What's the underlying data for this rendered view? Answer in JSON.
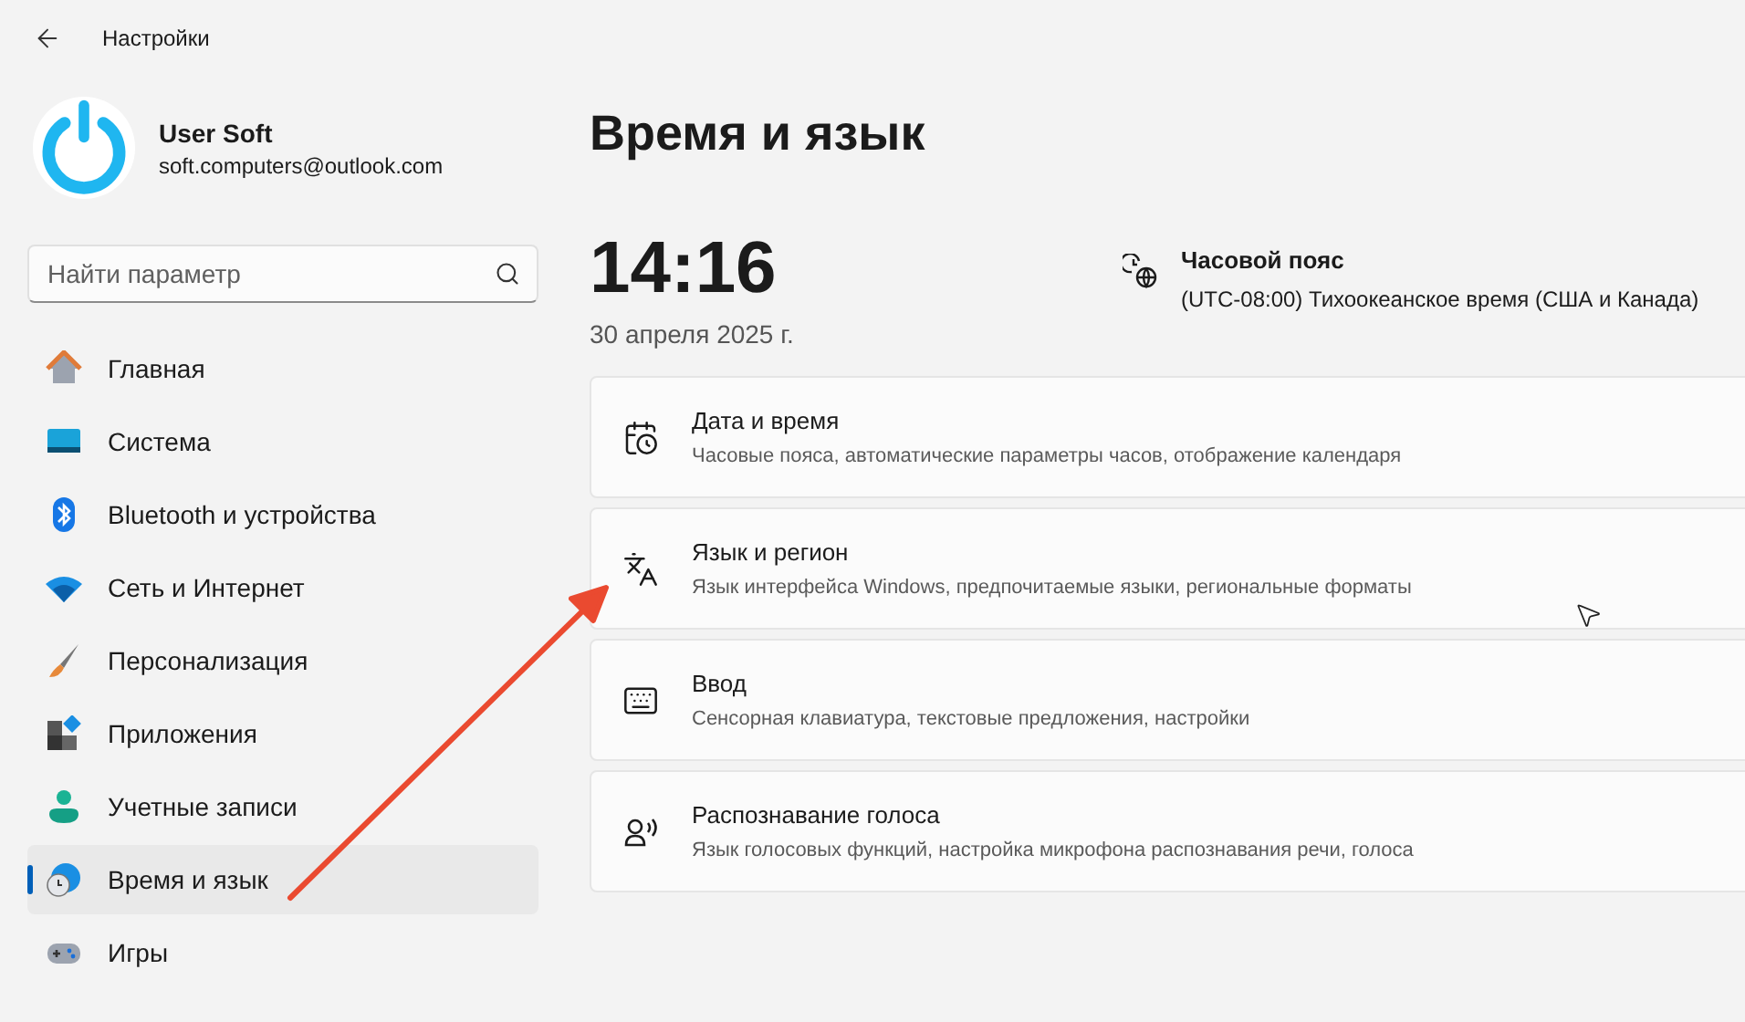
{
  "window": {
    "title": "Настройки"
  },
  "account": {
    "name": "User Soft",
    "email": "soft.computers@outlook.com"
  },
  "search": {
    "placeholder": "Найти параметр"
  },
  "sidebar": {
    "items": [
      {
        "kind": "home",
        "label": "Главная",
        "selected": false
      },
      {
        "kind": "system",
        "label": "Система",
        "selected": false
      },
      {
        "kind": "bluetooth",
        "label": "Bluetooth и устройства",
        "selected": false
      },
      {
        "kind": "network",
        "label": "Сеть и Интернет",
        "selected": false
      },
      {
        "kind": "personalize",
        "label": "Персонализация",
        "selected": false
      },
      {
        "kind": "apps",
        "label": "Приложения",
        "selected": false
      },
      {
        "kind": "accounts",
        "label": "Учетные записи",
        "selected": false
      },
      {
        "kind": "time",
        "label": "Время и язык",
        "selected": true
      },
      {
        "kind": "games",
        "label": "Игры",
        "selected": false
      }
    ]
  },
  "page": {
    "title": "Время и язык",
    "time": "14:16",
    "date": "30 апреля 2025 г.",
    "timezone": {
      "label": "Часовой пояс",
      "value": "(UTC-08:00) Тихоокеанское время (США и Канада)"
    }
  },
  "cards": [
    {
      "kind": "datetime",
      "title": "Дата и время",
      "description": "Часовые пояса, автоматические параметры часов, отображение календаря"
    },
    {
      "kind": "language",
      "title": "Язык и регион",
      "description": "Язык интерфейса Windows, предпочитаемые языки, региональные форматы"
    },
    {
      "kind": "typing",
      "title": "Ввод",
      "description": "Сенсорная клавиатура, текстовые предложения, настройки"
    },
    {
      "kind": "speech",
      "title": "Распознавание голоса",
      "description": "Язык голосовых функций, настройка микрофона распознавания речи, голоса"
    }
  ]
}
